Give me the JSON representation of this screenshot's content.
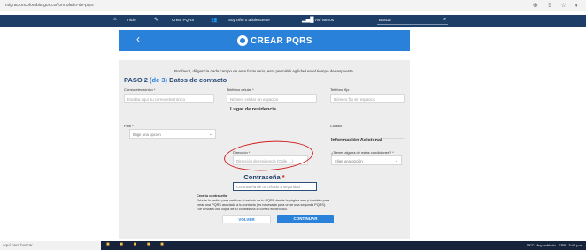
{
  "browser": {
    "url": "migracioncolombia.gov.co/formulario-de-pqrs",
    "icons": [
      "extension-icon",
      "share-icon",
      "star-icon",
      "profile-icon"
    ]
  },
  "nav": {
    "items": [
      "Inicio",
      "Crear PQRS",
      "Soy niño o adolescente",
      "Así vamos"
    ],
    "search_label": "Buscar"
  },
  "banner": {
    "title": "CREAR PQRS"
  },
  "form": {
    "intro": "Por favor, diligencia cada campo en este formulario, esto permitirá agilidad en el tiempo de respuesta.",
    "step_prefix": "PASO 2",
    "step_fraction": "(de 3)",
    "step_title": "Datos de contacto",
    "email": {
      "label": "Correo electrónico *",
      "placeholder": "Escriba aquí su correo electrónico"
    },
    "mobile": {
      "label": "Teléfono celular *",
      "placeholder": "Número celular sin espacios"
    },
    "landline": {
      "label": "Teléfono fijo",
      "placeholder": "Número fijo sin espacios"
    },
    "residence_heading": "Lugar de residencia",
    "country": {
      "label": "País *",
      "value": "Elige una opción"
    },
    "city": {
      "label": "Ciudad *",
      "value": ""
    },
    "address": {
      "label": "Dirección *",
      "placeholder": "Dirección de residencia (Calle, ...)"
    },
    "additional_heading": "Información Adicional",
    "minor": {
      "label": "¿Tienes alguna de estas condiciones? *",
      "value": "Elige una opción"
    },
    "password_heading": "Contraseña",
    "password_star": "*",
    "password_placeholder": "Contraseña de un cifrado a seguridad",
    "notes": [
      "Crea tu contraseña",
      "Esta te la pedirá para verificar el estado de tu PQRS desde la página web y también para",
      "crear una PQRS asociada a tu contacto (es necesaria para crear una segunda PQRS).",
      "*Se enviará una copia de tu contraseña al correo electrónico."
    ],
    "back_button": "VOLVER",
    "continue_button": "CONTINUAR"
  },
  "taskbar": {
    "search_text": "aquí para buscar",
    "weather": "15°C Muy nublado",
    "lang": "ESP",
    "time": "3:46 p.m."
  }
}
